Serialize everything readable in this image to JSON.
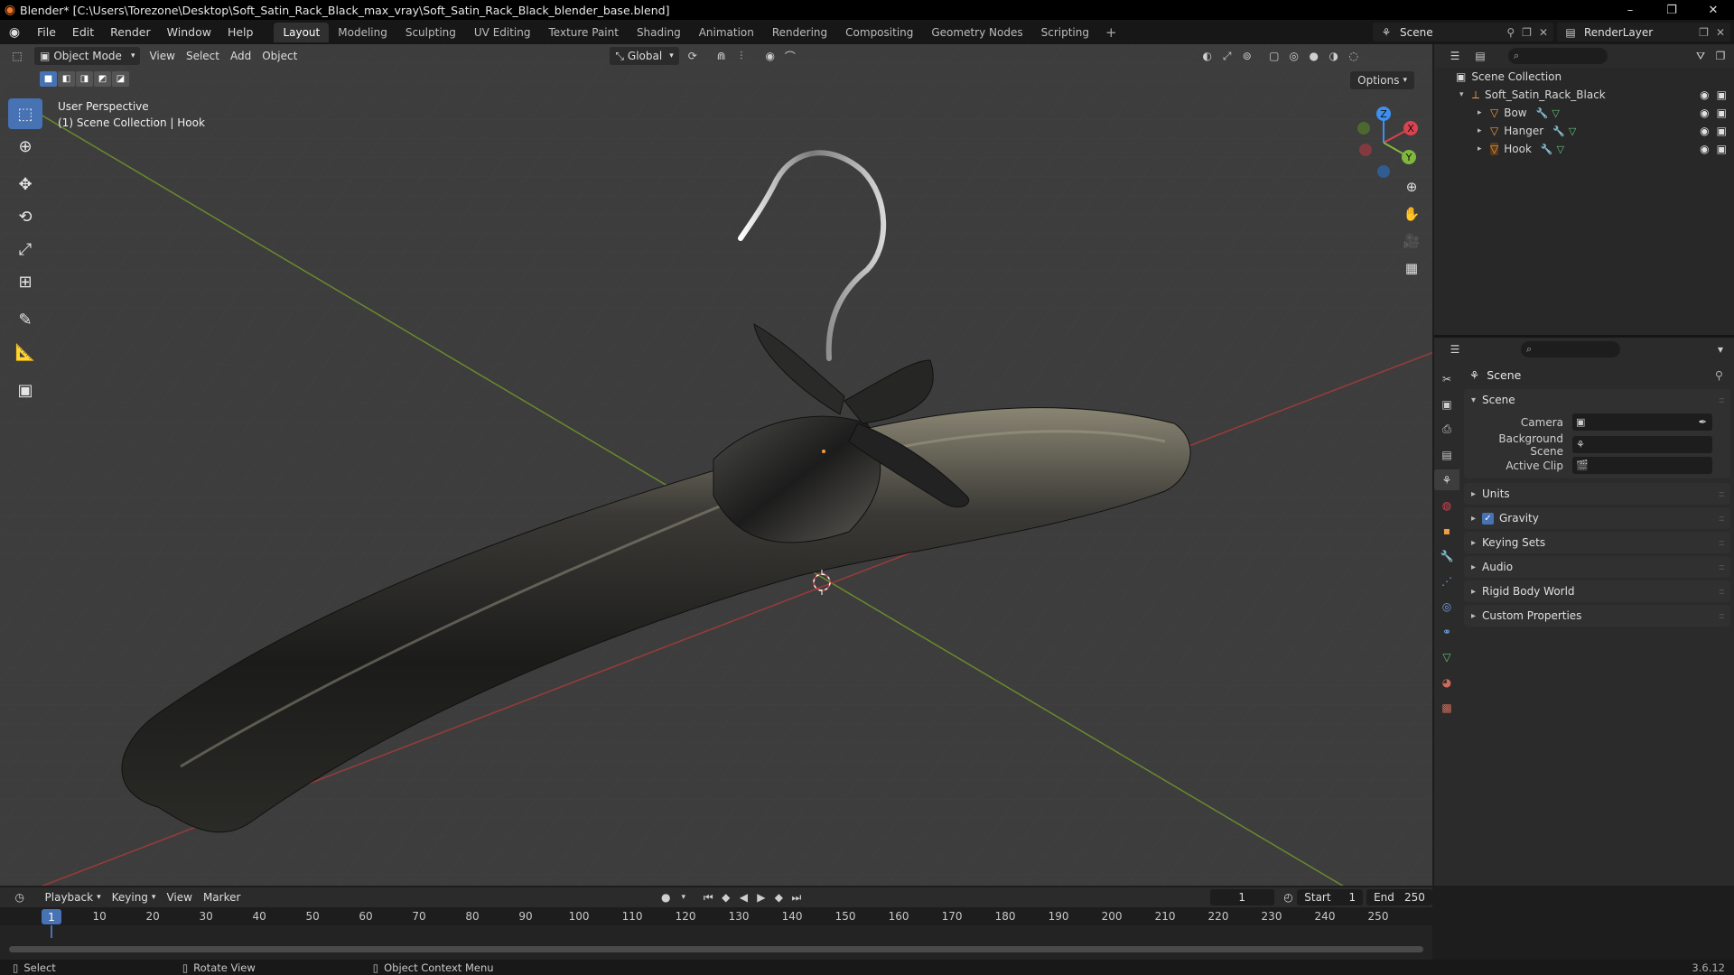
{
  "window": {
    "title": "Blender* [C:\\Users\\Torezone\\Desktop\\Soft_Satin_Rack_Black_max_vray\\Soft_Satin_Rack_Black_blender_base.blend]",
    "minimize": "–",
    "maximize": "❐",
    "close": "✕"
  },
  "menu": {
    "items": [
      "File",
      "Edit",
      "Render",
      "Window",
      "Help"
    ]
  },
  "workspaces": [
    "Layout",
    "Modeling",
    "Sculpting",
    "UV Editing",
    "Texture Paint",
    "Shading",
    "Animation",
    "Rendering",
    "Compositing",
    "Geometry Nodes",
    "Scripting"
  ],
  "workspace_add": "+",
  "scene_selector": {
    "label": "Scene"
  },
  "layer_selector": {
    "label": "RenderLayer"
  },
  "viewport": {
    "mode": "Object Mode",
    "menus": [
      "View",
      "Select",
      "Add",
      "Object"
    ],
    "transform_orientation": "Global",
    "options": "Options",
    "info_line1": "User Perspective",
    "info_line2": "(1) Scene Collection | Hook",
    "gizmo_axes": {
      "x": "X",
      "y": "Y",
      "z": "Z"
    },
    "colors": {
      "x_axis": "#d9424f",
      "y_axis": "#7fb83c",
      "z_axis": "#3f8ff0",
      "accent": "#4772b3"
    }
  },
  "outliner": {
    "root": "Scene Collection",
    "collection": "Soft_Satin_Rack_Black",
    "objects": [
      "Bow",
      "Hanger",
      "Hook"
    ]
  },
  "properties": {
    "context": "Scene",
    "section": "Scene",
    "fields": {
      "camera": "Camera",
      "background_scene": "Background Scene",
      "active_clip": "Active Clip"
    },
    "panels": {
      "units": "Units",
      "gravity": "Gravity",
      "keying_sets": "Keying Sets",
      "audio": "Audio",
      "rigid_body_world": "Rigid Body World",
      "custom_properties": "Custom Properties"
    },
    "gravity_checked": true
  },
  "timeline": {
    "menus": [
      "Playback",
      "Keying",
      "View",
      "Marker"
    ],
    "current_frame": "1",
    "start_label": "Start",
    "start": "1",
    "end_label": "End",
    "end": "250",
    "ticks": [
      "10",
      "20",
      "30",
      "40",
      "50",
      "60",
      "70",
      "80",
      "90",
      "100",
      "110",
      "120",
      "130",
      "140",
      "150",
      "160",
      "170",
      "180",
      "190",
      "200",
      "210",
      "220",
      "230",
      "240",
      "250"
    ],
    "playhead": "1"
  },
  "status": {
    "select": "Select",
    "rotate": "Rotate View",
    "context_menu": "Object Context Menu",
    "version": "3.6.12"
  }
}
